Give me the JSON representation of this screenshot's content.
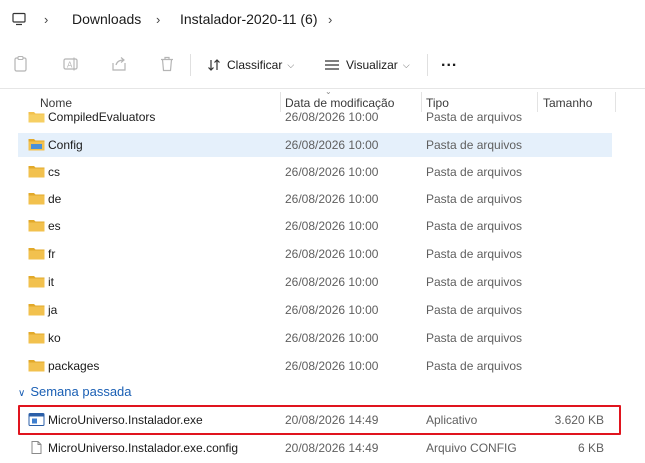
{
  "breadcrumb": {
    "items": [
      "Downloads",
      "Instalador-2020-11 (6)"
    ]
  },
  "toolbar": {
    "sort_label": "Classificar",
    "view_label": "Visualizar",
    "more_label": "..."
  },
  "columns": {
    "name": "Nome",
    "date": "Data de modificação",
    "type": "Tipo",
    "size": "Tamanho"
  },
  "rows": [
    {
      "name": "CompiledEvaluators",
      "date": "26/08/2026 10:00",
      "type": "Pasta de arquivos",
      "size": ""
    },
    {
      "name": "Config",
      "date": "26/08/2026 10:00",
      "type": "Pasta de arquivos",
      "size": ""
    },
    {
      "name": "cs",
      "date": "26/08/2026 10:00",
      "type": "Pasta de arquivos",
      "size": ""
    },
    {
      "name": "de",
      "date": "26/08/2026 10:00",
      "type": "Pasta de arquivos",
      "size": ""
    },
    {
      "name": "es",
      "date": "26/08/2026 10:00",
      "type": "Pasta de arquivos",
      "size": ""
    },
    {
      "name": "fr",
      "date": "26/08/2026 10:00",
      "type": "Pasta de arquivos",
      "size": ""
    },
    {
      "name": "it",
      "date": "26/08/2026 10:00",
      "type": "Pasta de arquivos",
      "size": ""
    },
    {
      "name": "ja",
      "date": "26/08/2026 10:00",
      "type": "Pasta de arquivos",
      "size": ""
    },
    {
      "name": "ko",
      "date": "26/08/2026 10:00",
      "type": "Pasta de arquivos",
      "size": ""
    },
    {
      "name": "packages",
      "date": "26/08/2026 10:00",
      "type": "Pasta de arquivos",
      "size": ""
    }
  ],
  "group": {
    "label": "Semana passada"
  },
  "group_rows": [
    {
      "name": "MicroUniverso.Instalador.exe",
      "date": "20/08/2026 14:49",
      "type": "Aplicativo",
      "size": "3.620 KB"
    },
    {
      "name": "MicroUniverso.Instalador.exe.config",
      "date": "20/08/2026 14:49",
      "type": "Arquivo CONFIG",
      "size": "6 KB"
    }
  ],
  "colors": {
    "folder": "#f2c14e",
    "selection": "#e5f0fb",
    "highlight": "#e0141e",
    "group_accent": "#1a5fb4"
  }
}
